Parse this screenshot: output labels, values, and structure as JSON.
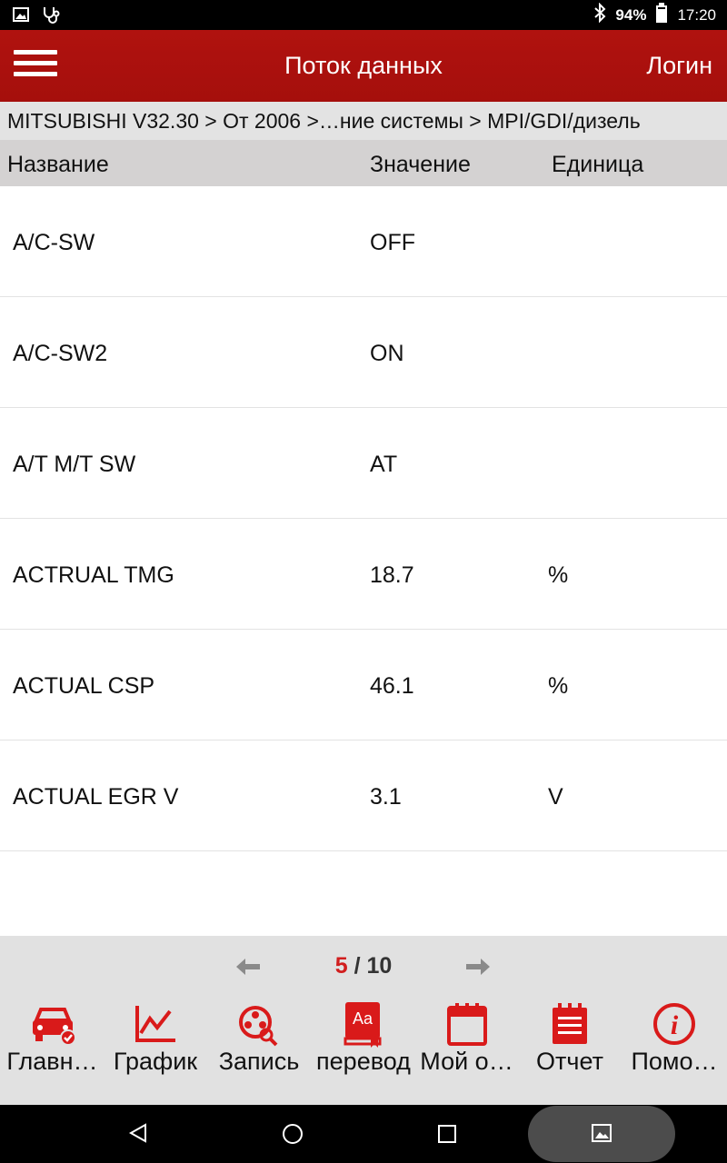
{
  "status_bar": {
    "battery_pct": "94%",
    "time": "17:20",
    "icons": [
      "gallery-icon",
      "stethoscope-icon",
      "bluetooth-icon",
      "battery-icon"
    ]
  },
  "app_bar": {
    "title": "Поток данных",
    "login_label": "Логин",
    "menu_icon": "hamburger-menu-icon"
  },
  "breadcrumb": "MITSUBISHI V32.30 > От 2006 >…ние системы > MPI/GDI/дизель",
  "table": {
    "headers": {
      "name": "Название",
      "value": "Значение",
      "unit": "Единица"
    },
    "rows": [
      {
        "name": "A/C-SW",
        "value": "OFF",
        "unit": ""
      },
      {
        "name": "A/C-SW2",
        "value": "ON",
        "unit": ""
      },
      {
        "name": "A/T M/T SW",
        "value": "AT",
        "unit": ""
      },
      {
        "name": "ACTRUAL TMG",
        "value": "18.7",
        "unit": "%"
      },
      {
        "name": "ACTUAL CSP",
        "value": "46.1",
        "unit": "%"
      },
      {
        "name": "ACTUAL EGR V",
        "value": "3.1",
        "unit": "V"
      }
    ]
  },
  "pagination": {
    "current": "5",
    "separator": " / ",
    "total": "10"
  },
  "toolbar": {
    "accent_color": "#d91a1a",
    "items": [
      {
        "label": "Главн…",
        "icon": "car-check-icon"
      },
      {
        "label": "График",
        "icon": "line-chart-icon"
      },
      {
        "label": "Запись",
        "icon": "film-reel-search-icon"
      },
      {
        "label": "перевод",
        "icon": "translate-book-icon"
      },
      {
        "label": "Мой о…",
        "icon": "calendar-icon"
      },
      {
        "label": "Отчет",
        "icon": "report-notepad-icon"
      },
      {
        "label": "Помо…",
        "icon": "info-icon"
      }
    ]
  },
  "nav_bar": {
    "buttons": [
      "back-icon",
      "home-icon",
      "recents-icon",
      "screenshot-icon"
    ]
  }
}
